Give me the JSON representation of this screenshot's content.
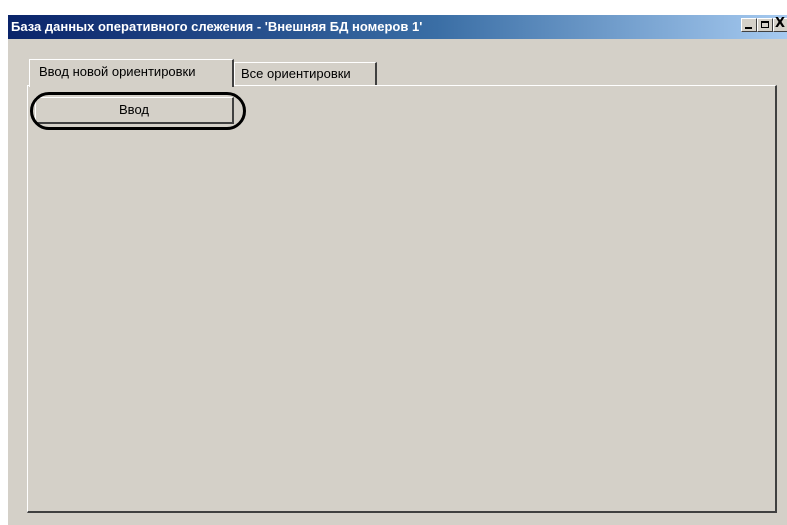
{
  "window": {
    "title": "База данных оперативного слежения - 'Внешняя БД номеров 1'",
    "title_bar_color": "#0a246a",
    "face_color": "#d4d0c8"
  },
  "title_controls": {
    "minimize_icon": "minimize-icon",
    "maximize_icon": "maximize-icon",
    "close_icon": "close-icon",
    "close_glyph": "X"
  },
  "tabs": [
    {
      "label": "Ввод новой ориентировки",
      "selected": true
    },
    {
      "label": "Все ориентировки",
      "selected": false
    }
  ],
  "panel": {
    "enter_button_label": "Ввод",
    "highlight_color": "#000000"
  }
}
